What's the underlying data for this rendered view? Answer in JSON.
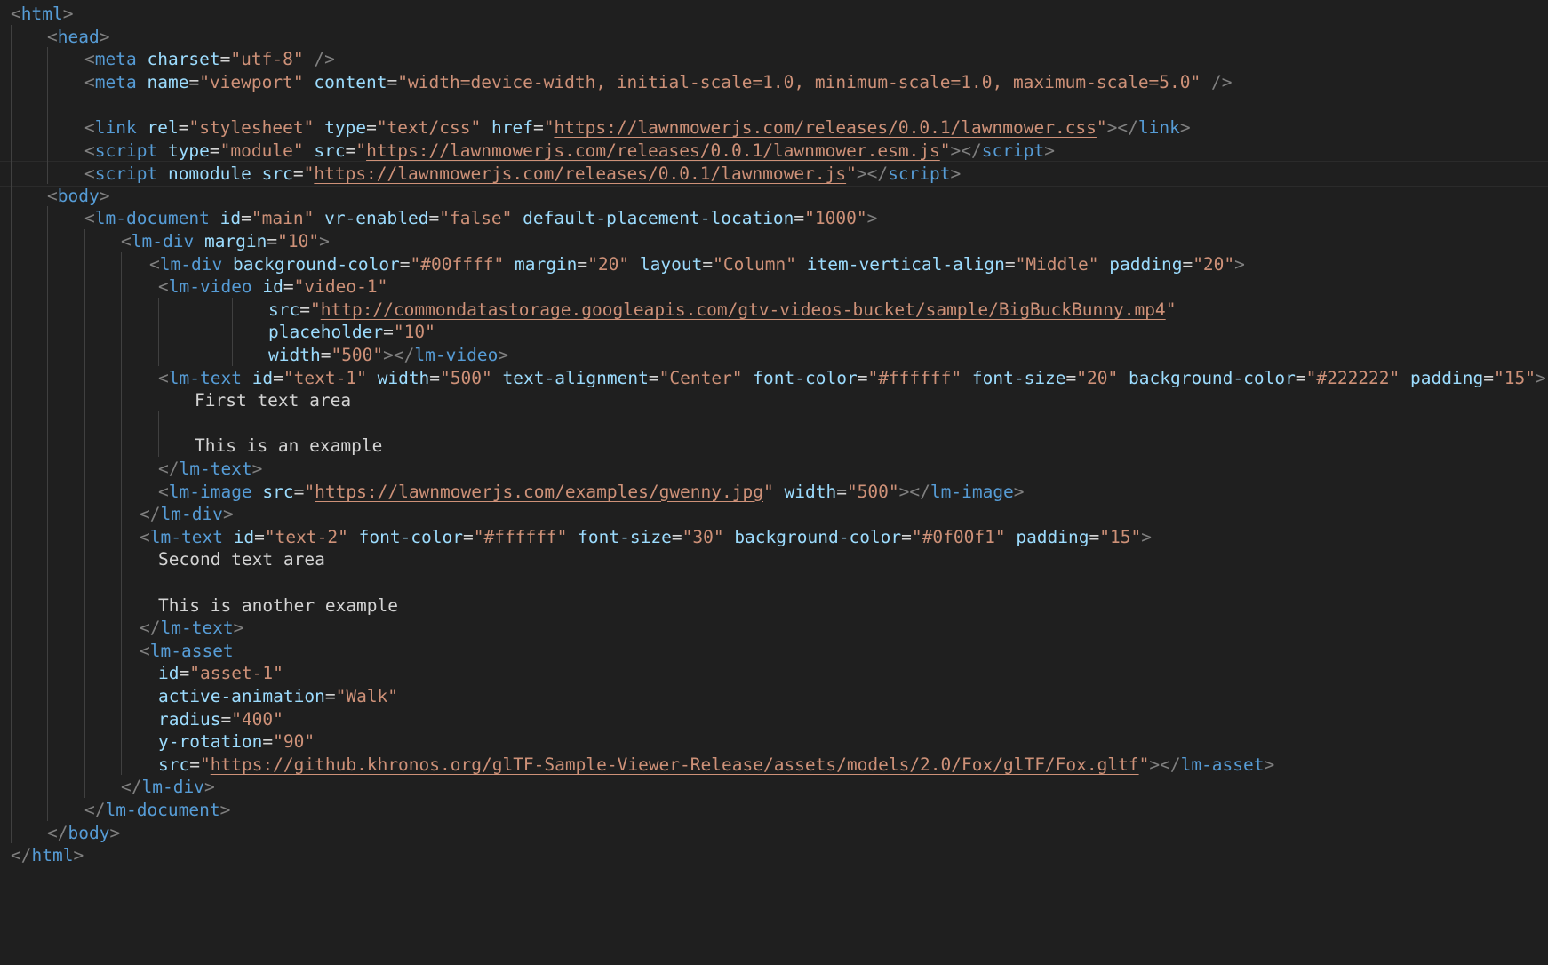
{
  "colors": {
    "background": "#1f1f1f",
    "tag": "#569cd6",
    "bracket": "#808080",
    "attribute": "#9cdcfe",
    "string": "#ce9178",
    "text": "#d4d4d4",
    "indent_guide": "#404040"
  },
  "lines": [
    {
      "tokens": [
        [
          "punct",
          "<"
        ],
        [
          "tag",
          "html"
        ],
        [
          "punct",
          ">"
        ]
      ]
    },
    {
      "tokens": [
        [
          "punct",
          "<"
        ],
        [
          "tag",
          "head"
        ],
        [
          "punct",
          ">"
        ]
      ]
    },
    {
      "tokens": [
        [
          "punct",
          "<"
        ],
        [
          "tag",
          "meta"
        ],
        [
          "text",
          " "
        ],
        [
          "attr",
          "charset"
        ],
        [
          "text",
          "="
        ],
        [
          "str",
          "\"utf-8\""
        ],
        [
          "text",
          " "
        ],
        [
          "punct",
          "/>"
        ]
      ]
    },
    {
      "tokens": [
        [
          "punct",
          "<"
        ],
        [
          "tag",
          "meta"
        ],
        [
          "text",
          " "
        ],
        [
          "attr",
          "name"
        ],
        [
          "text",
          "="
        ],
        [
          "str",
          "\"viewport\""
        ],
        [
          "text",
          " "
        ],
        [
          "attr",
          "content"
        ],
        [
          "text",
          "="
        ],
        [
          "str",
          "\"width=device-width, initial-scale=1.0, minimum-scale=1.0, maximum-scale=5.0\""
        ],
        [
          "text",
          " "
        ],
        [
          "punct",
          "/>"
        ]
      ]
    },
    {
      "tokens": []
    },
    {
      "tokens": [
        [
          "punct",
          "<"
        ],
        [
          "tag",
          "link"
        ],
        [
          "text",
          " "
        ],
        [
          "attr",
          "rel"
        ],
        [
          "text",
          "="
        ],
        [
          "str",
          "\"stylesheet\""
        ],
        [
          "text",
          " "
        ],
        [
          "attr",
          "type"
        ],
        [
          "text",
          "="
        ],
        [
          "str",
          "\"text/css\""
        ],
        [
          "text",
          " "
        ],
        [
          "attr",
          "href"
        ],
        [
          "text",
          "="
        ],
        [
          "str",
          "\""
        ],
        [
          "url",
          "https://lawnmowerjs.com/releases/0.0.1/lawnmower.css"
        ],
        [
          "str",
          "\""
        ],
        [
          "punct",
          "></"
        ],
        [
          "tag",
          "link"
        ],
        [
          "punct",
          ">"
        ]
      ]
    },
    {
      "tokens": [
        [
          "punct",
          "<"
        ],
        [
          "tag",
          "script"
        ],
        [
          "text",
          " "
        ],
        [
          "attr",
          "type"
        ],
        [
          "text",
          "="
        ],
        [
          "str",
          "\"module\""
        ],
        [
          "text",
          " "
        ],
        [
          "attr",
          "src"
        ],
        [
          "text",
          "="
        ],
        [
          "str",
          "\""
        ],
        [
          "url",
          "https://lawnmowerjs.com/releases/0.0.1/lawnmower.esm.js"
        ],
        [
          "str",
          "\""
        ],
        [
          "punct",
          "></"
        ],
        [
          "tag",
          "script"
        ],
        [
          "punct",
          ">"
        ]
      ]
    },
    {
      "tokens": [
        [
          "punct",
          "<"
        ],
        [
          "tag",
          "script"
        ],
        [
          "text",
          " "
        ],
        [
          "attr",
          "nomodule"
        ],
        [
          "text",
          " "
        ],
        [
          "attr",
          "src"
        ],
        [
          "text",
          "="
        ],
        [
          "str",
          "\""
        ],
        [
          "url",
          "https://lawnmowerjs.com/releases/0.0.1/lawnmower.js"
        ],
        [
          "str",
          "\""
        ],
        [
          "punct",
          "></"
        ],
        [
          "tag",
          "script"
        ],
        [
          "punct",
          ">"
        ]
      ]
    },
    {
      "tokens": [
        [
          "punct",
          "<"
        ],
        [
          "tag",
          "body"
        ],
        [
          "punct",
          ">"
        ]
      ]
    },
    {
      "tokens": [
        [
          "punct",
          "<"
        ],
        [
          "tag",
          "lm-document"
        ],
        [
          "text",
          " "
        ],
        [
          "attr",
          "id"
        ],
        [
          "text",
          "="
        ],
        [
          "str",
          "\"main\""
        ],
        [
          "text",
          " "
        ],
        [
          "attr",
          "vr-enabled"
        ],
        [
          "text",
          "="
        ],
        [
          "str",
          "\"false\""
        ],
        [
          "text",
          " "
        ],
        [
          "attr",
          "default-placement-location"
        ],
        [
          "text",
          "="
        ],
        [
          "str",
          "\"1000\""
        ],
        [
          "punct",
          ">"
        ]
      ]
    },
    {
      "tokens": [
        [
          "punct",
          "<"
        ],
        [
          "tag",
          "lm-div"
        ],
        [
          "text",
          " "
        ],
        [
          "attr",
          "margin"
        ],
        [
          "text",
          "="
        ],
        [
          "str",
          "\"10\""
        ],
        [
          "punct",
          ">"
        ]
      ]
    },
    {
      "tokens": [
        [
          "punct",
          "<"
        ],
        [
          "tag",
          "lm-div"
        ],
        [
          "text",
          " "
        ],
        [
          "attr",
          "background-color"
        ],
        [
          "text",
          "="
        ],
        [
          "str",
          "\"#00ffff\""
        ],
        [
          "text",
          " "
        ],
        [
          "attr",
          "margin"
        ],
        [
          "text",
          "="
        ],
        [
          "str",
          "\"20\""
        ],
        [
          "text",
          " "
        ],
        [
          "attr",
          "layout"
        ],
        [
          "text",
          "="
        ],
        [
          "str",
          "\"Column\""
        ],
        [
          "text",
          " "
        ],
        [
          "attr",
          "item-vertical-align"
        ],
        [
          "text",
          "="
        ],
        [
          "str",
          "\"Middle\""
        ],
        [
          "text",
          " "
        ],
        [
          "attr",
          "padding"
        ],
        [
          "text",
          "="
        ],
        [
          "str",
          "\"20\""
        ],
        [
          "punct",
          ">"
        ]
      ]
    },
    {
      "tokens": [
        [
          "punct",
          "<"
        ],
        [
          "tag",
          "lm-video"
        ],
        [
          "text",
          " "
        ],
        [
          "attr",
          "id"
        ],
        [
          "text",
          "="
        ],
        [
          "str",
          "\"video-1\""
        ]
      ]
    },
    {
      "tokens": [
        [
          "attr",
          "src"
        ],
        [
          "text",
          "="
        ],
        [
          "str",
          "\""
        ],
        [
          "url",
          "http://commondatastorage.googleapis.com/gtv-videos-bucket/sample/BigBuckBunny.mp4"
        ],
        [
          "str",
          "\""
        ]
      ]
    },
    {
      "tokens": [
        [
          "attr",
          "placeholder"
        ],
        [
          "text",
          "="
        ],
        [
          "str",
          "\"10\""
        ]
      ]
    },
    {
      "tokens": [
        [
          "attr",
          "width"
        ],
        [
          "text",
          "="
        ],
        [
          "str",
          "\"500\""
        ],
        [
          "punct",
          "></"
        ],
        [
          "tag",
          "lm-video"
        ],
        [
          "punct",
          ">"
        ]
      ]
    },
    {
      "tokens": [
        [
          "punct",
          "<"
        ],
        [
          "tag",
          "lm-text"
        ],
        [
          "text",
          " "
        ],
        [
          "attr",
          "id"
        ],
        [
          "text",
          "="
        ],
        [
          "str",
          "\"text-1\""
        ],
        [
          "text",
          " "
        ],
        [
          "attr",
          "width"
        ],
        [
          "text",
          "="
        ],
        [
          "str",
          "\"500\""
        ],
        [
          "text",
          " "
        ],
        [
          "attr",
          "text-alignment"
        ],
        [
          "text",
          "="
        ],
        [
          "str",
          "\"Center\""
        ],
        [
          "text",
          " "
        ],
        [
          "attr",
          "font-color"
        ],
        [
          "text",
          "="
        ],
        [
          "str",
          "\"#ffffff\""
        ],
        [
          "text",
          " "
        ],
        [
          "attr",
          "font-size"
        ],
        [
          "text",
          "="
        ],
        [
          "str",
          "\"20\""
        ],
        [
          "text",
          " "
        ],
        [
          "attr",
          "background-color"
        ],
        [
          "text",
          "="
        ],
        [
          "str",
          "\"#222222\""
        ],
        [
          "text",
          " "
        ],
        [
          "attr",
          "padding"
        ],
        [
          "text",
          "="
        ],
        [
          "str",
          "\"15\""
        ],
        [
          "punct",
          ">"
        ]
      ]
    },
    {
      "tokens": [
        [
          "text",
          "First text area"
        ]
      ]
    },
    {
      "tokens": []
    },
    {
      "tokens": [
        [
          "text",
          "This is an example"
        ]
      ]
    },
    {
      "tokens": [
        [
          "punct",
          "</"
        ],
        [
          "tag",
          "lm-text"
        ],
        [
          "punct",
          ">"
        ]
      ]
    },
    {
      "tokens": [
        [
          "punct",
          "<"
        ],
        [
          "tag",
          "lm-image"
        ],
        [
          "text",
          " "
        ],
        [
          "attr",
          "src"
        ],
        [
          "text",
          "="
        ],
        [
          "str",
          "\""
        ],
        [
          "url",
          "https://lawnmowerjs.com/examples/gwenny.jpg"
        ],
        [
          "str",
          "\""
        ],
        [
          "text",
          " "
        ],
        [
          "attr",
          "width"
        ],
        [
          "text",
          "="
        ],
        [
          "str",
          "\"500\""
        ],
        [
          "punct",
          "></"
        ],
        [
          "tag",
          "lm-image"
        ],
        [
          "punct",
          ">"
        ]
      ]
    },
    {
      "tokens": [
        [
          "punct",
          "</"
        ],
        [
          "tag",
          "lm-div"
        ],
        [
          "punct",
          ">"
        ]
      ]
    },
    {
      "tokens": [
        [
          "punct",
          "<"
        ],
        [
          "tag",
          "lm-text"
        ],
        [
          "text",
          " "
        ],
        [
          "attr",
          "id"
        ],
        [
          "text",
          "="
        ],
        [
          "str",
          "\"text-2\""
        ],
        [
          "text",
          " "
        ],
        [
          "attr",
          "font-color"
        ],
        [
          "text",
          "="
        ],
        [
          "str",
          "\"#ffffff\""
        ],
        [
          "text",
          " "
        ],
        [
          "attr",
          "font-size"
        ],
        [
          "text",
          "="
        ],
        [
          "str",
          "\"30\""
        ],
        [
          "text",
          " "
        ],
        [
          "attr",
          "background-color"
        ],
        [
          "text",
          "="
        ],
        [
          "str",
          "\"#0f00f1\""
        ],
        [
          "text",
          " "
        ],
        [
          "attr",
          "padding"
        ],
        [
          "text",
          "="
        ],
        [
          "str",
          "\"15\""
        ],
        [
          "punct",
          ">"
        ]
      ]
    },
    {
      "tokens": [
        [
          "text",
          "Second text area"
        ]
      ]
    },
    {
      "tokens": []
    },
    {
      "tokens": [
        [
          "text",
          "This is another example"
        ]
      ]
    },
    {
      "tokens": [
        [
          "punct",
          "</"
        ],
        [
          "tag",
          "lm-text"
        ],
        [
          "punct",
          ">"
        ]
      ]
    },
    {
      "tokens": [
        [
          "punct",
          "<"
        ],
        [
          "tag",
          "lm-asset"
        ]
      ]
    },
    {
      "tokens": [
        [
          "attr",
          "id"
        ],
        [
          "text",
          "="
        ],
        [
          "str",
          "\"asset-1\""
        ]
      ]
    },
    {
      "tokens": [
        [
          "attr",
          "active-animation"
        ],
        [
          "text",
          "="
        ],
        [
          "str",
          "\"Walk\""
        ]
      ]
    },
    {
      "tokens": [
        [
          "attr",
          "radius"
        ],
        [
          "text",
          "="
        ],
        [
          "str",
          "\"400\""
        ]
      ]
    },
    {
      "tokens": [
        [
          "attr",
          "y-rotation"
        ],
        [
          "text",
          "="
        ],
        [
          "str",
          "\"90\""
        ]
      ]
    },
    {
      "tokens": [
        [
          "attr",
          "src"
        ],
        [
          "text",
          "="
        ],
        [
          "str",
          "\""
        ],
        [
          "url",
          "https://github.khronos.org/glTF-Sample-Viewer-Release/assets/models/2.0/Fox/glTF/Fox.gltf"
        ],
        [
          "str",
          "\""
        ],
        [
          "punct",
          "></"
        ],
        [
          "tag",
          "lm-asset"
        ],
        [
          "punct",
          ">"
        ]
      ]
    },
    {
      "tokens": [
        [
          "punct",
          "</"
        ],
        [
          "tag",
          "lm-div"
        ],
        [
          "punct",
          ">"
        ]
      ]
    },
    {
      "tokens": [
        [
          "punct",
          "</"
        ],
        [
          "tag",
          "lm-document"
        ],
        [
          "punct",
          ">"
        ]
      ]
    },
    {
      "tokens": [
        [
          "punct",
          "</"
        ],
        [
          "tag",
          "body"
        ],
        [
          "punct",
          ">"
        ]
      ]
    },
    {
      "tokens": [
        [
          "punct",
          "</"
        ],
        [
          "tag",
          "html"
        ],
        [
          "punct",
          ">"
        ]
      ]
    }
  ]
}
